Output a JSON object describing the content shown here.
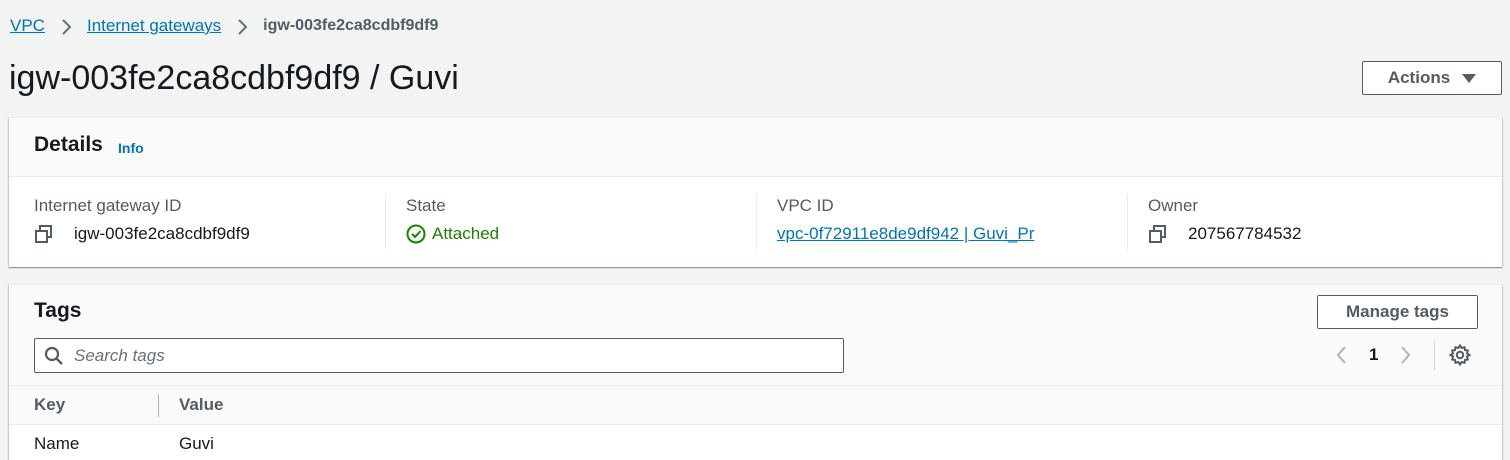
{
  "breadcrumb": {
    "items": [
      "VPC",
      "Internet gateways"
    ],
    "current": "igw-003fe2ca8cdbf9df9"
  },
  "page": {
    "title": "igw-003fe2ca8cdbf9df9 / Guvi",
    "actions_label": "Actions"
  },
  "details": {
    "title": "Details",
    "info_label": "Info",
    "fields": [
      {
        "label": "Internet gateway ID",
        "value": "igw-003fe2ca8cdbf9df9"
      },
      {
        "label": "State",
        "value": "Attached"
      },
      {
        "label": "VPC ID",
        "value": "vpc-0f72911e8de9df942 | Guvi_Pr"
      },
      {
        "label": "Owner",
        "value": "207567784532"
      }
    ]
  },
  "tags": {
    "title": "Tags",
    "manage_label": "Manage tags",
    "search_placeholder": "Search tags",
    "page_number": "1",
    "columns": [
      "Key",
      "Value"
    ],
    "rows": [
      {
        "key": "Name",
        "value": "Guvi"
      }
    ]
  },
  "colors": {
    "link": "#0073bb",
    "success": "#1d8102",
    "text": "#16191f",
    "muted": "#545b64",
    "background": "#f2f3f3"
  },
  "icons": {
    "copy": "copy-icon",
    "status_ok": "check-circle-icon",
    "search": "search-icon",
    "settings": "gear-icon",
    "prev": "chevron-left-icon",
    "next": "chevron-right-icon",
    "caret": "caret-down-icon"
  }
}
